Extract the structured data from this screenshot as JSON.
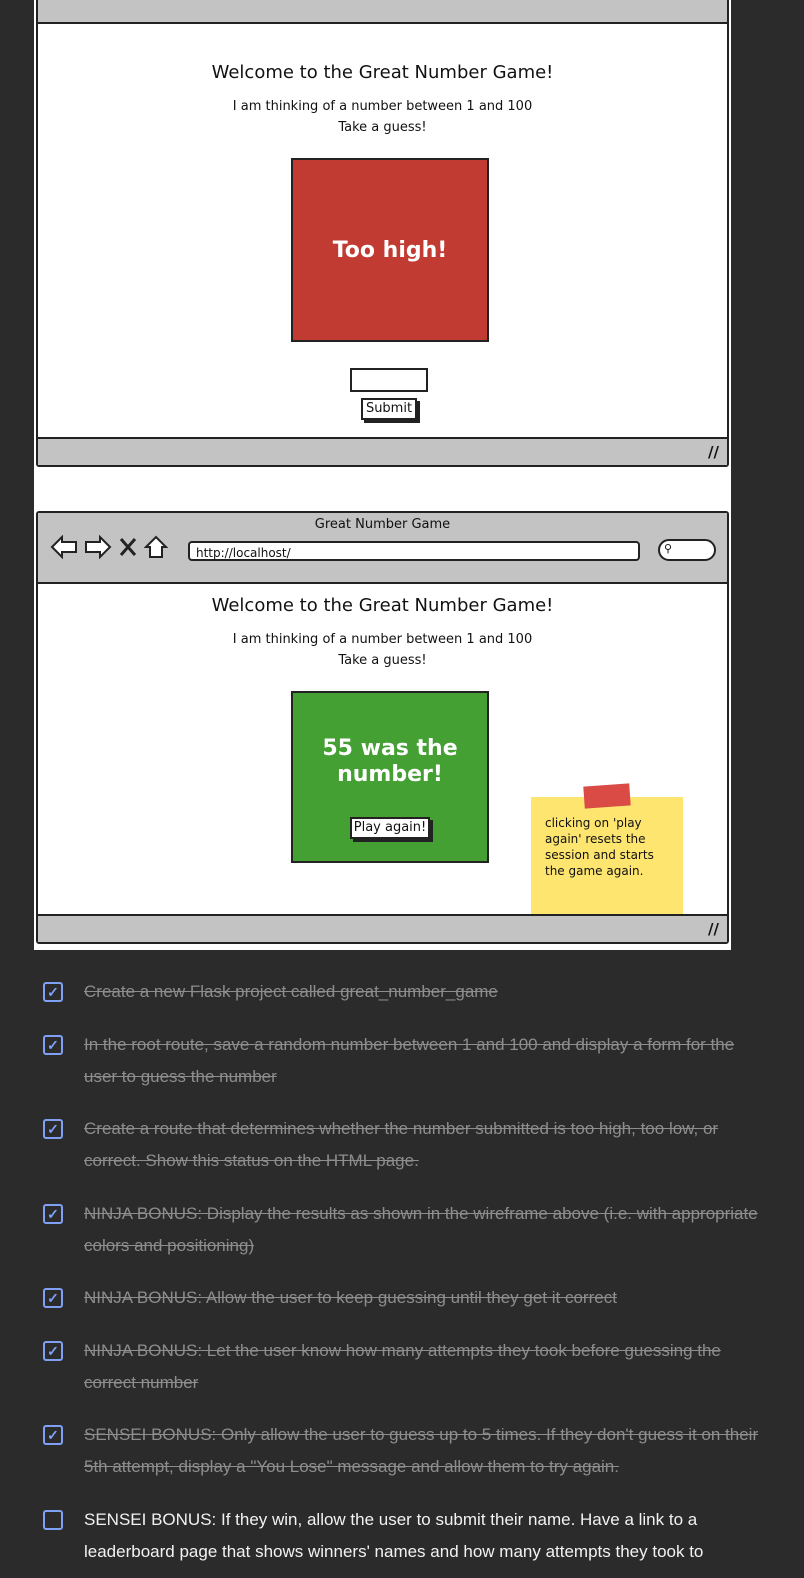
{
  "wireframe1": {
    "heading": "Welcome to the Great Number Game!",
    "line1": "I am thinking of a number between 1 and 100",
    "line2": "Take a guess!",
    "status": "Too high!",
    "status_color": "#c13b32",
    "submit_label": "Submit"
  },
  "wireframe2": {
    "window_title": "Great Number Game",
    "url": "http://localhost/",
    "heading": "Welcome to the Great Number Game!",
    "line1": "I am thinking of a number between 1 and 100",
    "line2": "Take a guess!",
    "status": "55 was the number!",
    "status_color": "#44a033",
    "play_again_label": "Play again!",
    "sticky_note": "clicking on 'play again' resets the session and starts the game again.",
    "sticky_color": "#fde56f",
    "tape_color": "#d94b44"
  },
  "checklist": {
    "items": [
      {
        "text": "Create a new Flask project called great_number_game",
        "done": true
      },
      {
        "text": "In the root route, save a random number between 1 and 100 and display a form for the user to guess the number",
        "done": true
      },
      {
        "text": "Create a route that determines whether the number submitted is too high, too low, or correct. Show this status on the HTML page.",
        "done": true
      },
      {
        "text": "NINJA BONUS: Display the results as shown in the wireframe above (i.e. with appropriate colors and positioning)",
        "done": true
      },
      {
        "text": "NINJA BONUS: Allow the user to keep guessing until they get it correct",
        "done": true
      },
      {
        "text": "NINJA BONUS: Let the user know how many attempts they took before guessing the correct number",
        "done": true
      },
      {
        "text": "SENSEI BONUS: Only allow the user to guess up to 5 times. If they don't guess it on their 5th attempt, display a \"You Lose\" message and allow them to try again.",
        "done": true
      },
      {
        "text": "SENSEI BONUS: If they win, allow the user to submit their name. Have a link to a leaderboard page that shows winners' names and how many attempts they took to",
        "done": false
      }
    ],
    "check_color": "#7fa0f4",
    "done_text_color": "#8d8d8d",
    "open_text_color": "#f2f2f2"
  }
}
